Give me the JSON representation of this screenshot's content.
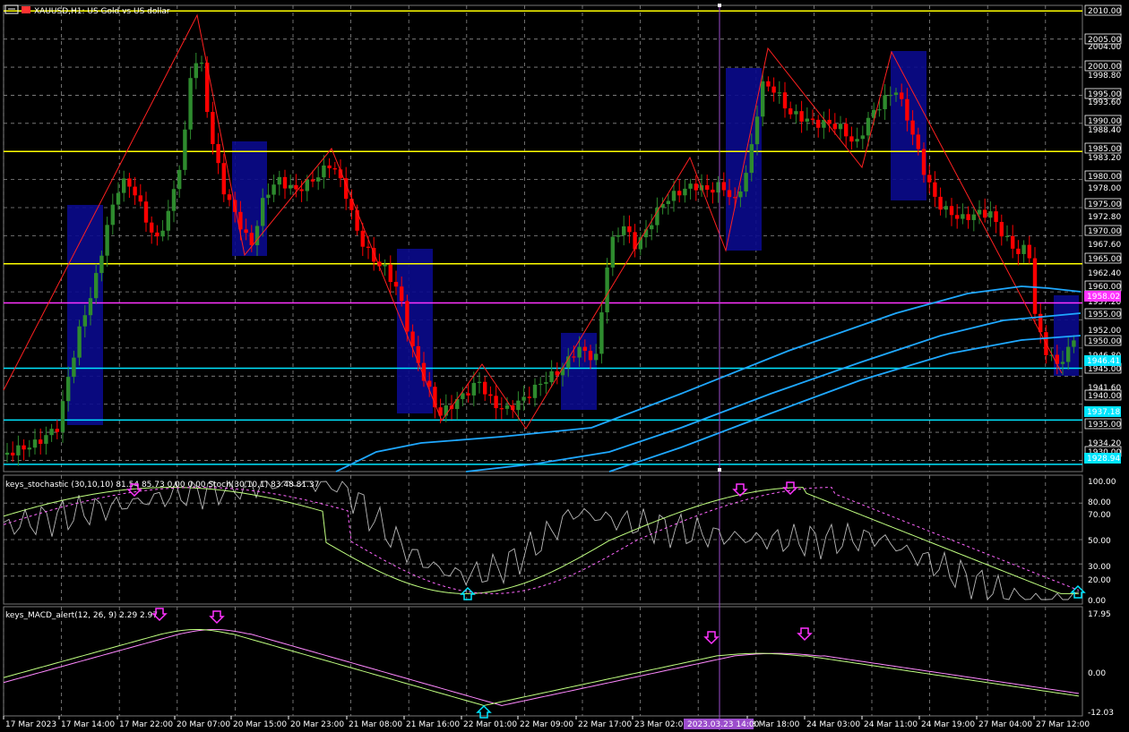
{
  "window": {
    "title": "XAUUSD,H1: US Gold vs US dollar",
    "icon": "chart-window-icon"
  },
  "colors": {
    "background": "#000000",
    "grid": "#8a8a8a",
    "bull": "#2e8b2e",
    "bear": "#ff0000",
    "zigzag": "#ff2020",
    "ma": "#1fa8ff",
    "yellow_level": "#ffff00",
    "cyan_level": "#00e5ff",
    "magenta_level": "#ff33ff",
    "zone": "#0a0a8c",
    "crosshair": "#9c4dcc",
    "stoch_main": "#b8b8b8",
    "stoch_signal": "#c0ff80",
    "stoch_dash": "#ff66ff",
    "macd_main": "#c0ff80",
    "macd_signal": "#ff88ff",
    "arrow_down": "#ff33ff",
    "arrow_up": "#00e5ff"
  },
  "price_axis": {
    "labels": [
      "2010.00",
      "2005.00",
      "2004.00",
      "2000.00",
      "1998.80",
      "1995.00",
      "1993.60",
      "1990.00",
      "1988.40",
      "1985.00",
      "1983.20",
      "1980.00",
      "1978.00",
      "1975.00",
      "1972.80",
      "1970.00",
      "1967.60",
      "1965.00",
      "1962.40",
      "1960.00",
      "1957.20",
      "1955.00",
      "1952.00",
      "1950.00",
      "1946.80",
      "1945.00",
      "1941.60",
      "1940.00",
      "1936.40",
      "1935.00",
      "1934.20",
      "1930.00",
      "1928.94"
    ],
    "boxed": [
      "2010.00",
      "2005.00",
      "2000.00",
      "1995.00",
      "1990.00",
      "1985.00",
      "1980.00",
      "1975.00",
      "1970.00",
      "1965.00",
      "1960.00",
      "1955.00",
      "1950.00",
      "1945.00",
      "1940.00",
      "1935.00",
      "1930.00"
    ],
    "highlights": [
      {
        "price": "1958.02",
        "color": "#ff33ff"
      },
      {
        "price": "1946.41",
        "color": "#00e5ff"
      },
      {
        "price": "1937.18",
        "color": "#00e5ff"
      },
      {
        "price": "1928.94",
        "color": "#00e5ff"
      }
    ],
    "price_range": [
      1928.0,
      2011.0
    ]
  },
  "levels": [
    {
      "price": 2010.0,
      "color": "#ffff00"
    },
    {
      "price": 1985.0,
      "color": "#ffff00"
    },
    {
      "price": 1965.0,
      "color": "#ffff00"
    },
    {
      "price": 1958.02,
      "color": "#ff33ff"
    },
    {
      "price": 1946.41,
      "color": "#00e5ff"
    },
    {
      "price": 1937.18,
      "color": "#00e5ff"
    },
    {
      "price": 1929.3,
      "color": "#00e5ff"
    }
  ],
  "time_axis": {
    "labels": [
      "17 Mar 2023",
      "17 Mar 14:00",
      "17 Mar 22:00",
      "20 Mar 07:00",
      "20 Mar 15:00",
      "20 Mar 23:00",
      "21 Mar 08:00",
      "21 Mar 16:00",
      "22 Mar 01:00",
      "22 Mar 09:00",
      "22 Mar 17:00",
      "23 Mar 02:00",
      "23 Mar 18:00",
      "24 Mar 03:00",
      "24 Mar 11:00",
      "24 Mar 19:00",
      "27 Mar 04:00",
      "27 Mar 12:00"
    ],
    "cursor_label": "2023.03.23 14:00"
  },
  "stoch_panel": {
    "title": "keys_stochastic (30,10,10) 81.54 85.73 0.00 0.00 Stoch(30,10,1) 83.48 81.37",
    "axis": [
      "100.00",
      "80.00",
      "70.00",
      "50.00",
      "30.00",
      "20.00",
      "0.00"
    ]
  },
  "macd_panel": {
    "title": "keys_MACD_alert(12, 26, 9) 2.29 2.97",
    "axis": [
      "17.95",
      "0.00",
      "-12.03"
    ]
  }
}
